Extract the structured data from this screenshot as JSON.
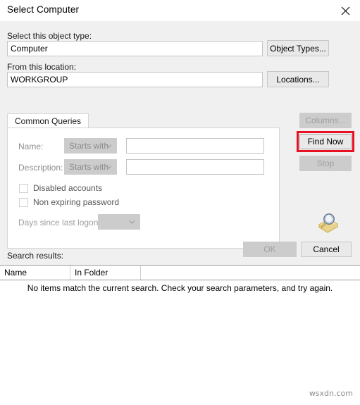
{
  "window": {
    "title": "Select Computer",
    "close_icon": "close-icon"
  },
  "object_type": {
    "label": "Select this object type:",
    "value": "Computer",
    "button_label": "Object Types..."
  },
  "location": {
    "label": "From this location:",
    "value": "WORKGROUP",
    "button_label": "Locations..."
  },
  "tabs": [
    {
      "label": "Common Queries",
      "selected": true
    }
  ],
  "query": {
    "name": {
      "label": "Name:",
      "operator": "Starts with",
      "value": "",
      "placeholder": ""
    },
    "description": {
      "label": "Description:",
      "operator": "Starts with",
      "value": "",
      "placeholder": ""
    },
    "disabled_accounts": {
      "label": "Disabled accounts",
      "checked": false
    },
    "non_expiring_password": {
      "label": "Non expiring password",
      "checked": false
    },
    "days_since_last_logon": {
      "label": "Days since last logon:",
      "value": ""
    }
  },
  "side_buttons": {
    "columns": "Columns...",
    "find_now": "Find Now",
    "stop": "Stop",
    "search_icon": "magnifier-over-folder-icon",
    "highlight_color": "#e81123"
  },
  "dialog_buttons": {
    "ok": "OK",
    "cancel": "Cancel"
  },
  "results": {
    "label": "Search results:",
    "columns": [
      "Name",
      "In Folder",
      ""
    ],
    "rows": [],
    "empty_message": "No items match the current search. Check your search parameters, and try again."
  },
  "watermark": {
    "text": "wsxdn.com"
  }
}
